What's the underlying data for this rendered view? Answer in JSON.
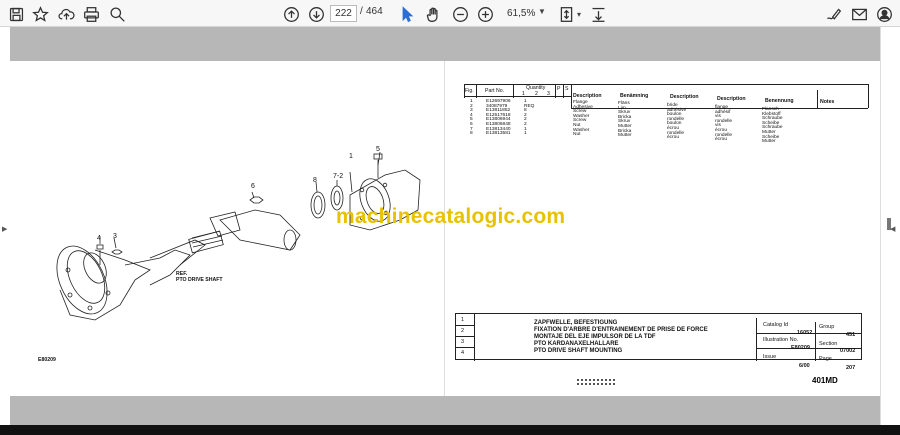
{
  "toolbar": {
    "current_page": "222",
    "separator": "/",
    "total_pages": "464",
    "zoom": "61,5%"
  },
  "drawing": {
    "callouts": [
      "1",
      "5",
      "7-2",
      "8",
      "6",
      "4",
      "3"
    ],
    "ref_label": "REF.",
    "ref_text": "PTO DRIVE SHAFT",
    "drawing_code": "E80209"
  },
  "watermark": "machinecatalogic.com",
  "parts_table": {
    "headers": {
      "fig": "Fig.",
      "part_no": "Part No.",
      "quantity": "Quantity",
      "q1": "1",
      "q2": "2",
      "q3": "3",
      "p": "P",
      "s": "S",
      "description_en": "Description",
      "benamning": "Benämning",
      "description_fr": "Description",
      "description_es": "Description",
      "benennung": "Benennung",
      "notes": "Notes"
    },
    "fig_col": "1\n2\n3\n4\n5\n6\n7\n8",
    "part_col": "E12697906\n34087979\nE13811852\nE12517618\nE13806944\nE13806848\nE13813440\nE13813581",
    "qty_col": "1\nREQ\n8\n2\n2\n2\n1\n1",
    "en_col": "Flange\nAdhesive\nScrew\nWasher\nScrew\nNut\nWasher\nNut",
    "sv_col": "Fläns\nLim\nSkruv\nBricka\nSkruv\nMutter\nBricka\nMutter",
    "fr_col": "bride\nadhésive\nboulon\nrondelle\nboulon\nécrou\nrondelle\nécrou",
    "es_col": "brida\nadhesivo\ntornillo\narandela\ntornillo\ntuerca\narandela\ntuerca",
    "it_col": "flange\nadhésif\nvis\nrondelle\nvis\nécrou\nrondelle\nécrou",
    "de_col": "Flansch\nKlebstoff\nSchraube\nScheibe\nSchraube\nMutter\nScheibe\nMutter"
  },
  "title_block": {
    "rows": [
      "1",
      "2",
      "3",
      "4"
    ],
    "line1": "ZAPFWELLE, BEFESTIGUNG",
    "line2": "FIXATION D'ARBRE D'ENTRAINEMENT DE PRISE DE FORCE",
    "line3": "MONTAJE DEL EJE IMPULSOR DE LA TDF",
    "line4": "PTO KARDANAXELHALLARE",
    "line5": "PTO DRIVE SHAFT MOUNTING",
    "catalog_id_label": "Catalog Id",
    "catalog_id": "16052",
    "group_label": "Group",
    "group": "451",
    "illustration_label": "Illustration No.",
    "illustration": "E80209",
    "section_label": "Section",
    "section": "07002",
    "issue_label": "Issue",
    "issue": "6/00",
    "page_label": "Page",
    "page": "207"
  },
  "model": "401MD"
}
